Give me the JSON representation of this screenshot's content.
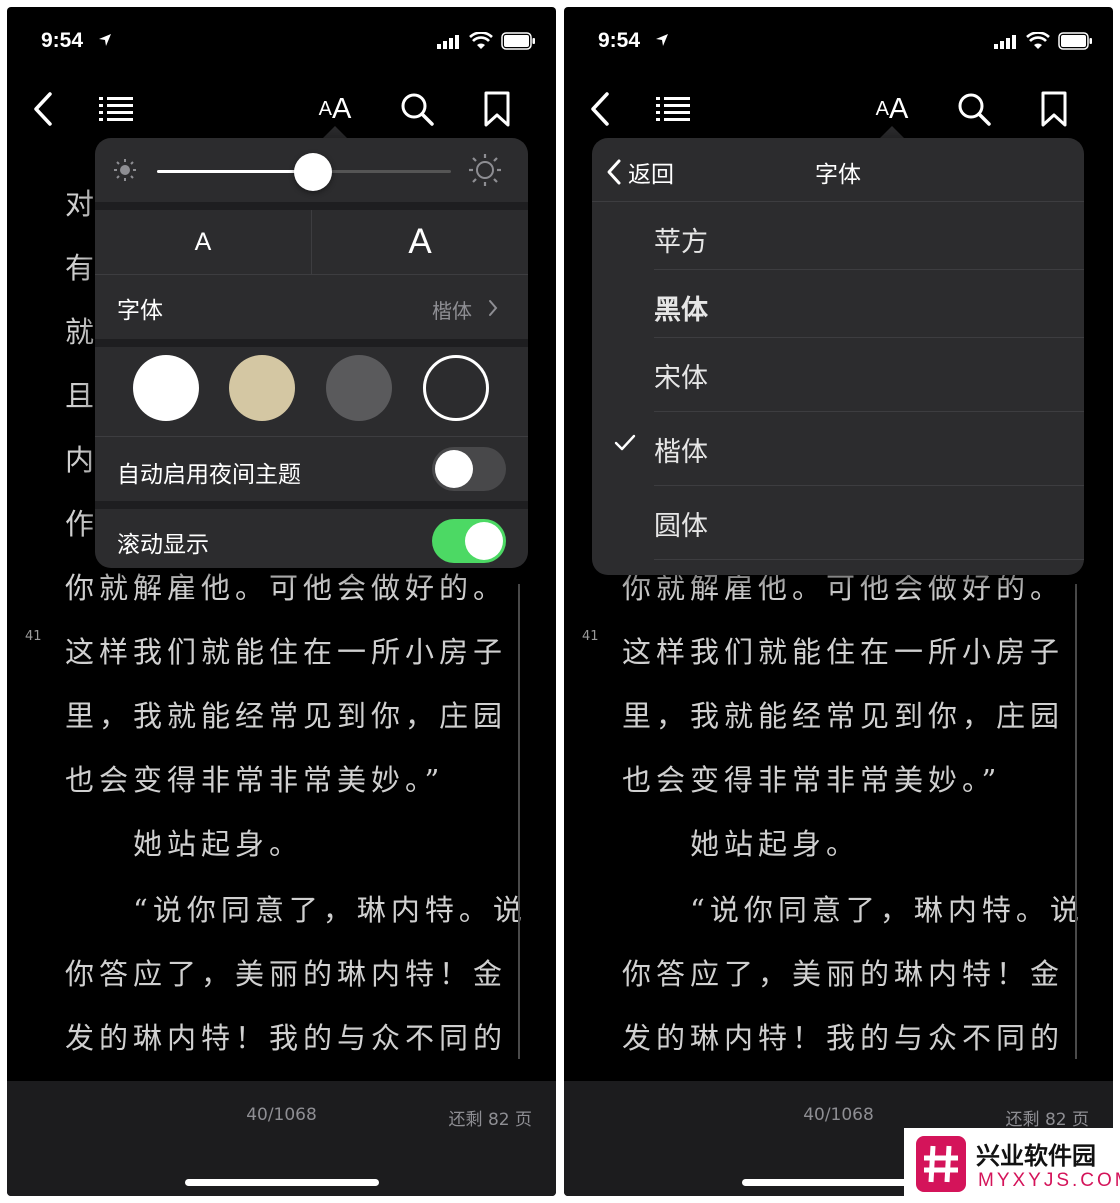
{
  "status": {
    "time": "9:54"
  },
  "toolbar": {
    "aa_small": "A",
    "aa_big": "A"
  },
  "content": {
    "lines": [
      {
        "text": "对"
      },
      {
        "text": "有"
      },
      {
        "text": "就"
      },
      {
        "text": "且"
      },
      {
        "text": "内"
      },
      {
        "text": "作"
      },
      {
        "text": "你就解雇他。可他会做好的。"
      },
      {
        "text": "这样我们就能住在一所小房子"
      },
      {
        "text": "里，我就能经常见到你，庄园"
      },
      {
        "text": "也会变得非常非常美妙。”"
      },
      {
        "text": "　　她站起身。"
      },
      {
        "text": "　　“说你同意了，琳内特。说"
      },
      {
        "text": "你答应了，美丽的琳内特！金"
      },
      {
        "text": "发的琳内特！我的与众不同的"
      }
    ],
    "page_marker": "41"
  },
  "bottom": {
    "page": "40/1068",
    "remaining": "还剩 82 页"
  },
  "settings": {
    "brightness": 0.53,
    "font_small": "A",
    "font_large": "A",
    "font_label": "字体",
    "font_value": "楷体",
    "themes": [
      {
        "name": "white",
        "color": "#ffffff"
      },
      {
        "name": "sepia",
        "color": "#d4c7a3"
      },
      {
        "name": "gray",
        "color": "#5a5a5c"
      },
      {
        "name": "dark",
        "color": "#2c2c2e",
        "selected": true
      }
    ],
    "night_label": "自动启用夜间主题",
    "night_on": false,
    "scroll_label": "滚动显示",
    "scroll_on": true,
    "accent": "#4cd964"
  },
  "font_menu": {
    "back": "返回",
    "title": "字体",
    "items": [
      {
        "name": "苹方",
        "checked": false
      },
      {
        "name": "黑体",
        "checked": false
      },
      {
        "name": "宋体",
        "checked": false
      },
      {
        "name": "楷体",
        "checked": true
      },
      {
        "name": "圆体",
        "checked": false
      }
    ]
  },
  "watermark": {
    "cn": "兴业软件园",
    "en": "MYXYJS.COM"
  }
}
